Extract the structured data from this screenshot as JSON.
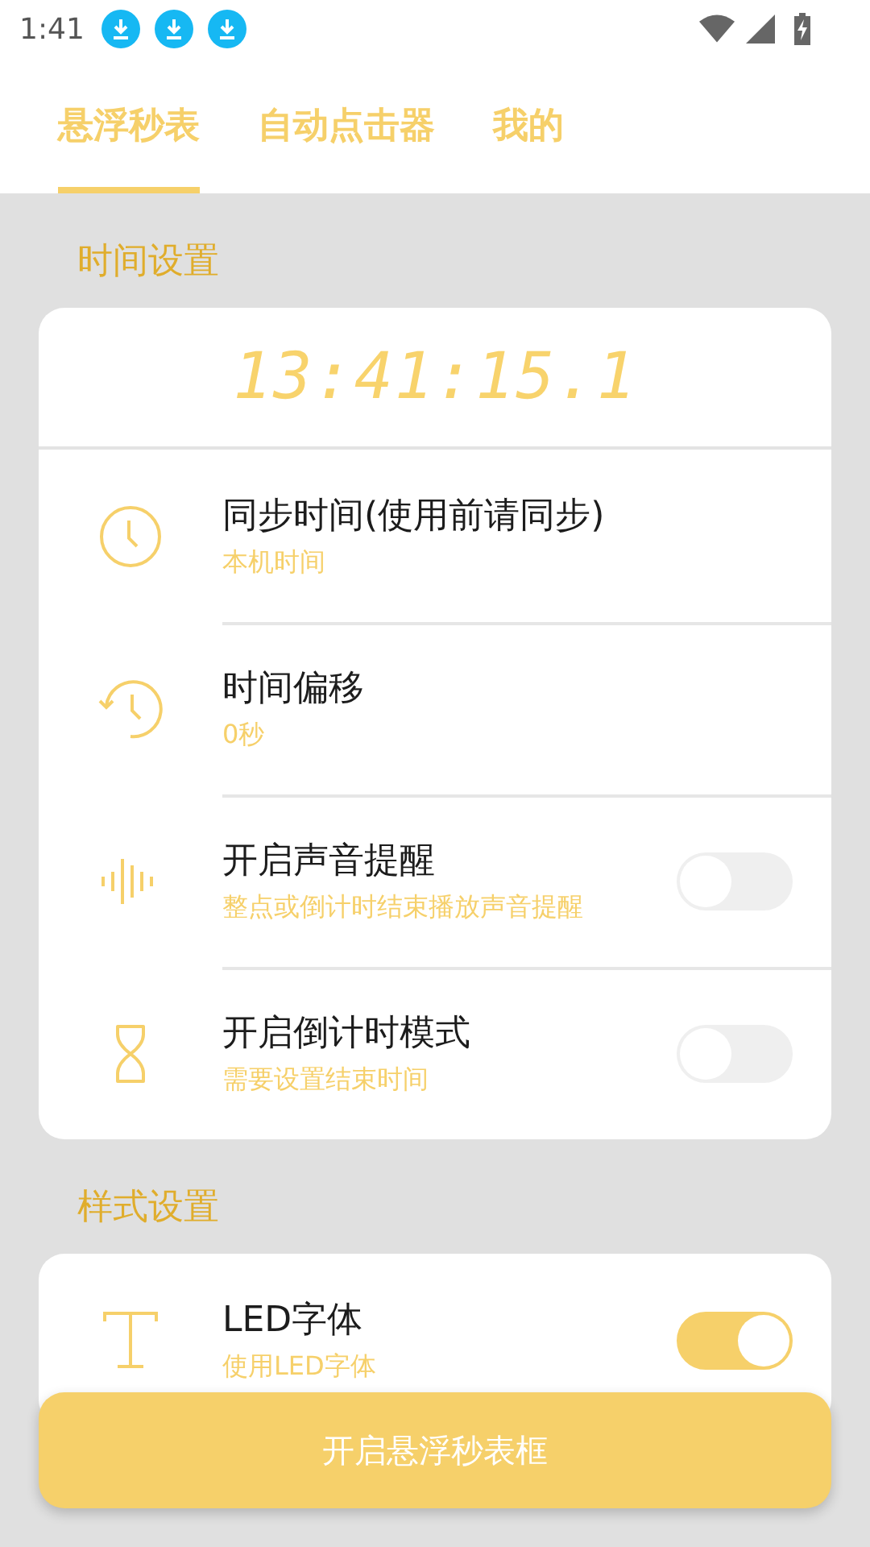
{
  "status_bar": {
    "time": "1:41"
  },
  "tabs": [
    {
      "label": "悬浮秒表",
      "selected": true
    },
    {
      "label": "自动点击器",
      "selected": false
    },
    {
      "label": "我的",
      "selected": false
    }
  ],
  "sections": [
    {
      "title": "时间设置",
      "clock": "13:41:15.1",
      "rows": [
        {
          "kind": "value",
          "title": "同步时间(使用前请同步)",
          "subtitle": "本机时间"
        },
        {
          "kind": "value",
          "title": "时间偏移",
          "subtitle": "0秒"
        },
        {
          "kind": "toggle",
          "title": "开启声音提醒",
          "subtitle": "整点或倒计时结束播放声音提醒",
          "on": false
        },
        {
          "kind": "toggle",
          "title": "开启倒计时模式",
          "subtitle": "需要设置结束时间",
          "on": false
        }
      ]
    },
    {
      "title": "样式设置",
      "rows": [
        {
          "kind": "toggle",
          "title": "LED字体",
          "subtitle": "使用LED字体",
          "on": true
        }
      ]
    }
  ],
  "float_button": "开启悬浮秒表框"
}
